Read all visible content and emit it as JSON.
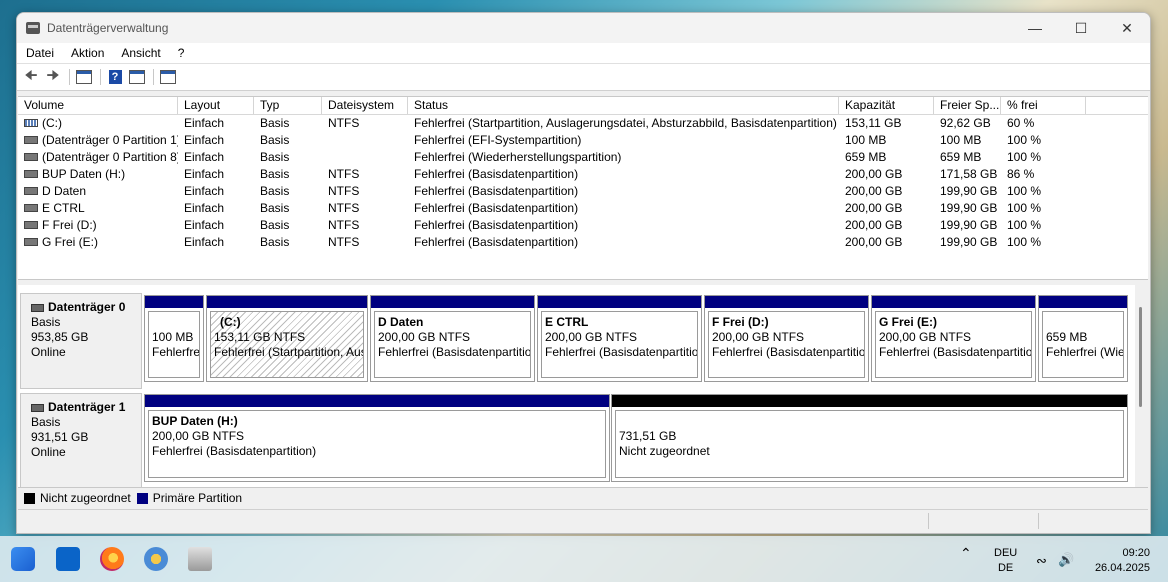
{
  "window": {
    "title": "Datenträgerverwaltung",
    "controls": {
      "minimize": "—",
      "maximize": "☐",
      "close": "✕"
    }
  },
  "menu": [
    "Datei",
    "Aktion",
    "Ansicht",
    "?"
  ],
  "toolbar_icons": [
    "back-arrow-icon",
    "forward-arrow-icon",
    "show-hide-console-icon",
    "help-icon",
    "properties-icon",
    "export-list-icon"
  ],
  "columns": [
    "Volume",
    "Layout",
    "Typ",
    "Dateisystem",
    "Status",
    "Kapazität",
    "Freier Sp...",
    "% frei"
  ],
  "volumes": [
    {
      "volume": "(C:)",
      "layout": "Einfach",
      "typ": "Basis",
      "fs": "NTFS",
      "status": "Fehlerfrei (Startpartition, Auslagerungsdatei, Absturzabbild, Basisdatenpartition)",
      "kapazitaet": "153,11 GB",
      "frei": "92,62 GB",
      "pct": "60 %",
      "icon": "system-volume-icon"
    },
    {
      "volume": "(Datenträger 0 Partition 1)",
      "layout": "Einfach",
      "typ": "Basis",
      "fs": "",
      "status": "Fehlerfrei (EFI-Systempartition)",
      "kapazitaet": "100 MB",
      "frei": "100 MB",
      "pct": "100 %",
      "icon": "volume-icon"
    },
    {
      "volume": "(Datenträger 0 Partition 8)",
      "layout": "Einfach",
      "typ": "Basis",
      "fs": "",
      "status": "Fehlerfrei (Wiederherstellungspartition)",
      "kapazitaet": "659 MB",
      "frei": "659 MB",
      "pct": "100 %",
      "icon": "volume-icon"
    },
    {
      "volume": "BUP Daten (H:)",
      "layout": "Einfach",
      "typ": "Basis",
      "fs": "NTFS",
      "status": "Fehlerfrei (Basisdatenpartition)",
      "kapazitaet": "200,00 GB",
      "frei": "171,58 GB",
      "pct": "86 %",
      "icon": "volume-icon"
    },
    {
      "volume": "D Daten",
      "layout": "Einfach",
      "typ": "Basis",
      "fs": "NTFS",
      "status": "Fehlerfrei (Basisdatenpartition)",
      "kapazitaet": "200,00 GB",
      "frei": "199,90 GB",
      "pct": "100 %",
      "icon": "volume-icon"
    },
    {
      "volume": "E CTRL",
      "layout": "Einfach",
      "typ": "Basis",
      "fs": "NTFS",
      "status": "Fehlerfrei (Basisdatenpartition)",
      "kapazitaet": "200,00 GB",
      "frei": "199,90 GB",
      "pct": "100 %",
      "icon": "volume-icon"
    },
    {
      "volume": "F Frei (D:)",
      "layout": "Einfach",
      "typ": "Basis",
      "fs": "NTFS",
      "status": "Fehlerfrei (Basisdatenpartition)",
      "kapazitaet": "200,00 GB",
      "frei": "199,90 GB",
      "pct": "100 %",
      "icon": "volume-icon"
    },
    {
      "volume": "G Frei (E:)",
      "layout": "Einfach",
      "typ": "Basis",
      "fs": "NTFS",
      "status": "Fehlerfrei (Basisdatenpartition)",
      "kapazitaet": "200,00 GB",
      "frei": "199,90 GB",
      "pct": "100 %",
      "icon": "volume-icon"
    }
  ],
  "disks": [
    {
      "name": "Datenträger 0",
      "type": "Basis",
      "size": "953,85 GB",
      "state": "Online",
      "partitions": [
        {
          "name": "",
          "size": "100 MB",
          "status": "Fehlerfrei (EFI-Systempartition)"
        },
        {
          "name": "(C:)",
          "size": "153,11 GB NTFS",
          "status": "Fehlerfrei (Startpartition, Auslagerungsdatei, Absturzabbild, Basisdatenpartition)"
        },
        {
          "name": "D Daten",
          "size": "200,00 GB NTFS",
          "status": "Fehlerfrei (Basisdatenpartition)"
        },
        {
          "name": "E CTRL",
          "size": "200,00 GB NTFS",
          "status": "Fehlerfrei (Basisdatenpartition)"
        },
        {
          "name": "F Frei  (D:)",
          "size": "200,00 GB NTFS",
          "status": "Fehlerfrei (Basisdatenpartition)"
        },
        {
          "name": "G Frei  (E:)",
          "size": "200,00 GB NTFS",
          "status": "Fehlerfrei (Basisdatenpartition)"
        },
        {
          "name": "",
          "size": "659 MB",
          "status": "Fehlerfrei (Wiederherstellungspartition)"
        }
      ]
    },
    {
      "name": "Datenträger 1",
      "type": "Basis",
      "size": "931,51 GB",
      "state": "Online",
      "partitions": [
        {
          "name": "BUP Daten  (H:)",
          "size": "200,00 GB NTFS",
          "status": "Fehlerfrei (Basisdatenpartition)"
        },
        {
          "name": "",
          "size": "731,51 GB",
          "status": "Nicht zugeordnet"
        }
      ]
    }
  ],
  "legend": [
    {
      "label": "Nicht zugeordnet",
      "color": "#000000"
    },
    {
      "label": "Primäre Partition",
      "color": "#000080"
    }
  ],
  "taskbar": {
    "apps": [
      "start-icon",
      "outlook-icon",
      "firefox-icon",
      "settings-icon",
      "disk-management-icon"
    ],
    "lang_top": "DEU",
    "lang_bottom": "DE",
    "time": "09:20",
    "date": "26.04.2025"
  }
}
